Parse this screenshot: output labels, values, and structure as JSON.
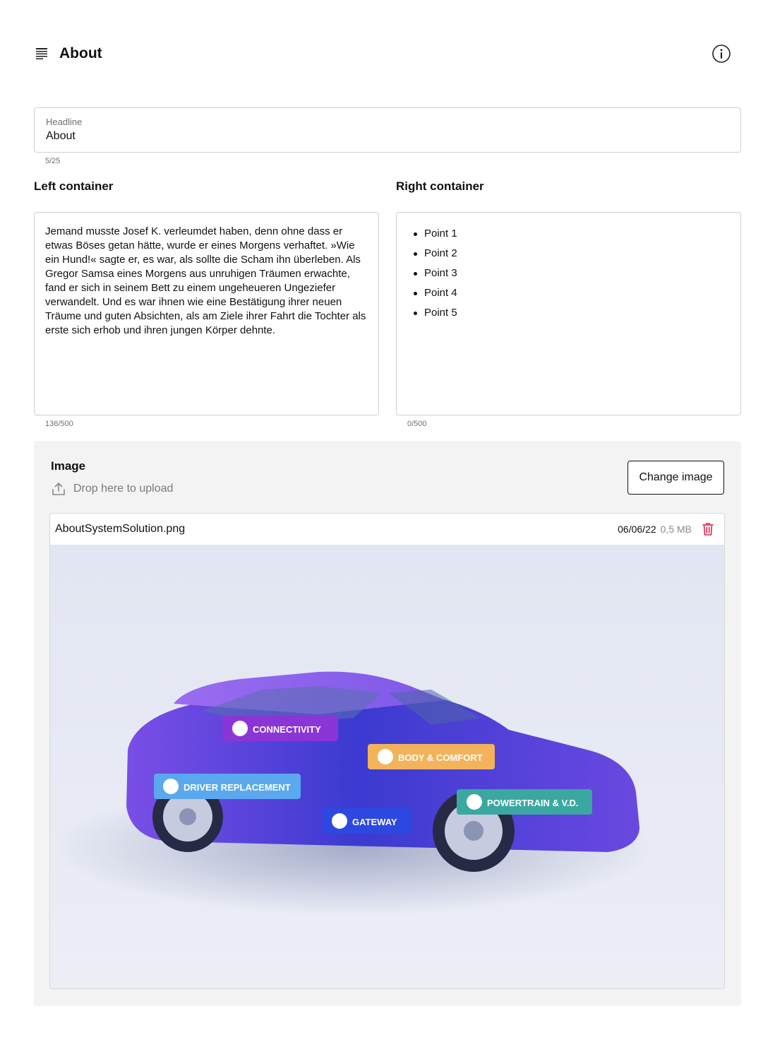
{
  "header": {
    "title": "About",
    "page_icon": "document-lines-icon",
    "info_icon": "info-icon"
  },
  "headline": {
    "label": "Headline",
    "value": "About",
    "counter": "5/25"
  },
  "left_container": {
    "title": "Left container",
    "text": "Jemand musste Josef K. verleumdet haben, denn ohne dass er etwas Böses getan hätte, wurde er eines Morgens verhaftet. »Wie ein Hund!« sagte er, es war, als sollte die Scham ihn überleben. Als Gregor Samsa eines Morgens aus unruhigen Träumen erwachte, fand er sich in seinem Bett zu einem ungeheueren Ungeziefer verwandelt. Und es war ihnen wie eine Bestätigung ihrer neuen Träume und guten Absichten, als am Ziele ihrer Fahrt die Tochter als erste sich erhob und ihren jungen Körper dehnte.",
    "counter": "136/500"
  },
  "right_container": {
    "title": "Right container",
    "items": [
      "Point 1",
      "Point 2",
      "Point 3",
      "Point 4",
      "Point 5"
    ],
    "counter": "0/500"
  },
  "image": {
    "title": "Image",
    "drop_text": "Drop here to upload",
    "change_label": "Change image",
    "file_name": "AboutSystemSolution.png",
    "file_date": "06/06/22",
    "file_size": "0,5 MB",
    "delete_color": "#e0224f",
    "preview": {
      "car_colors": [
        "#7a4ee6",
        "#3b3ad0",
        "#2f6fd6"
      ],
      "tags": [
        {
          "label": "CONNECTIVITY",
          "color": "#8a35d6"
        },
        {
          "label": "BODY & COMFORT",
          "color": "#f2b35a"
        },
        {
          "label": "DRIVER REPLACEMENT",
          "color": "#5aa8ee"
        },
        {
          "label": "GATEWAY",
          "color": "#2c48e0"
        },
        {
          "label": "POWERTRAIN & V.D.",
          "color": "#3aa8a0"
        }
      ]
    }
  }
}
